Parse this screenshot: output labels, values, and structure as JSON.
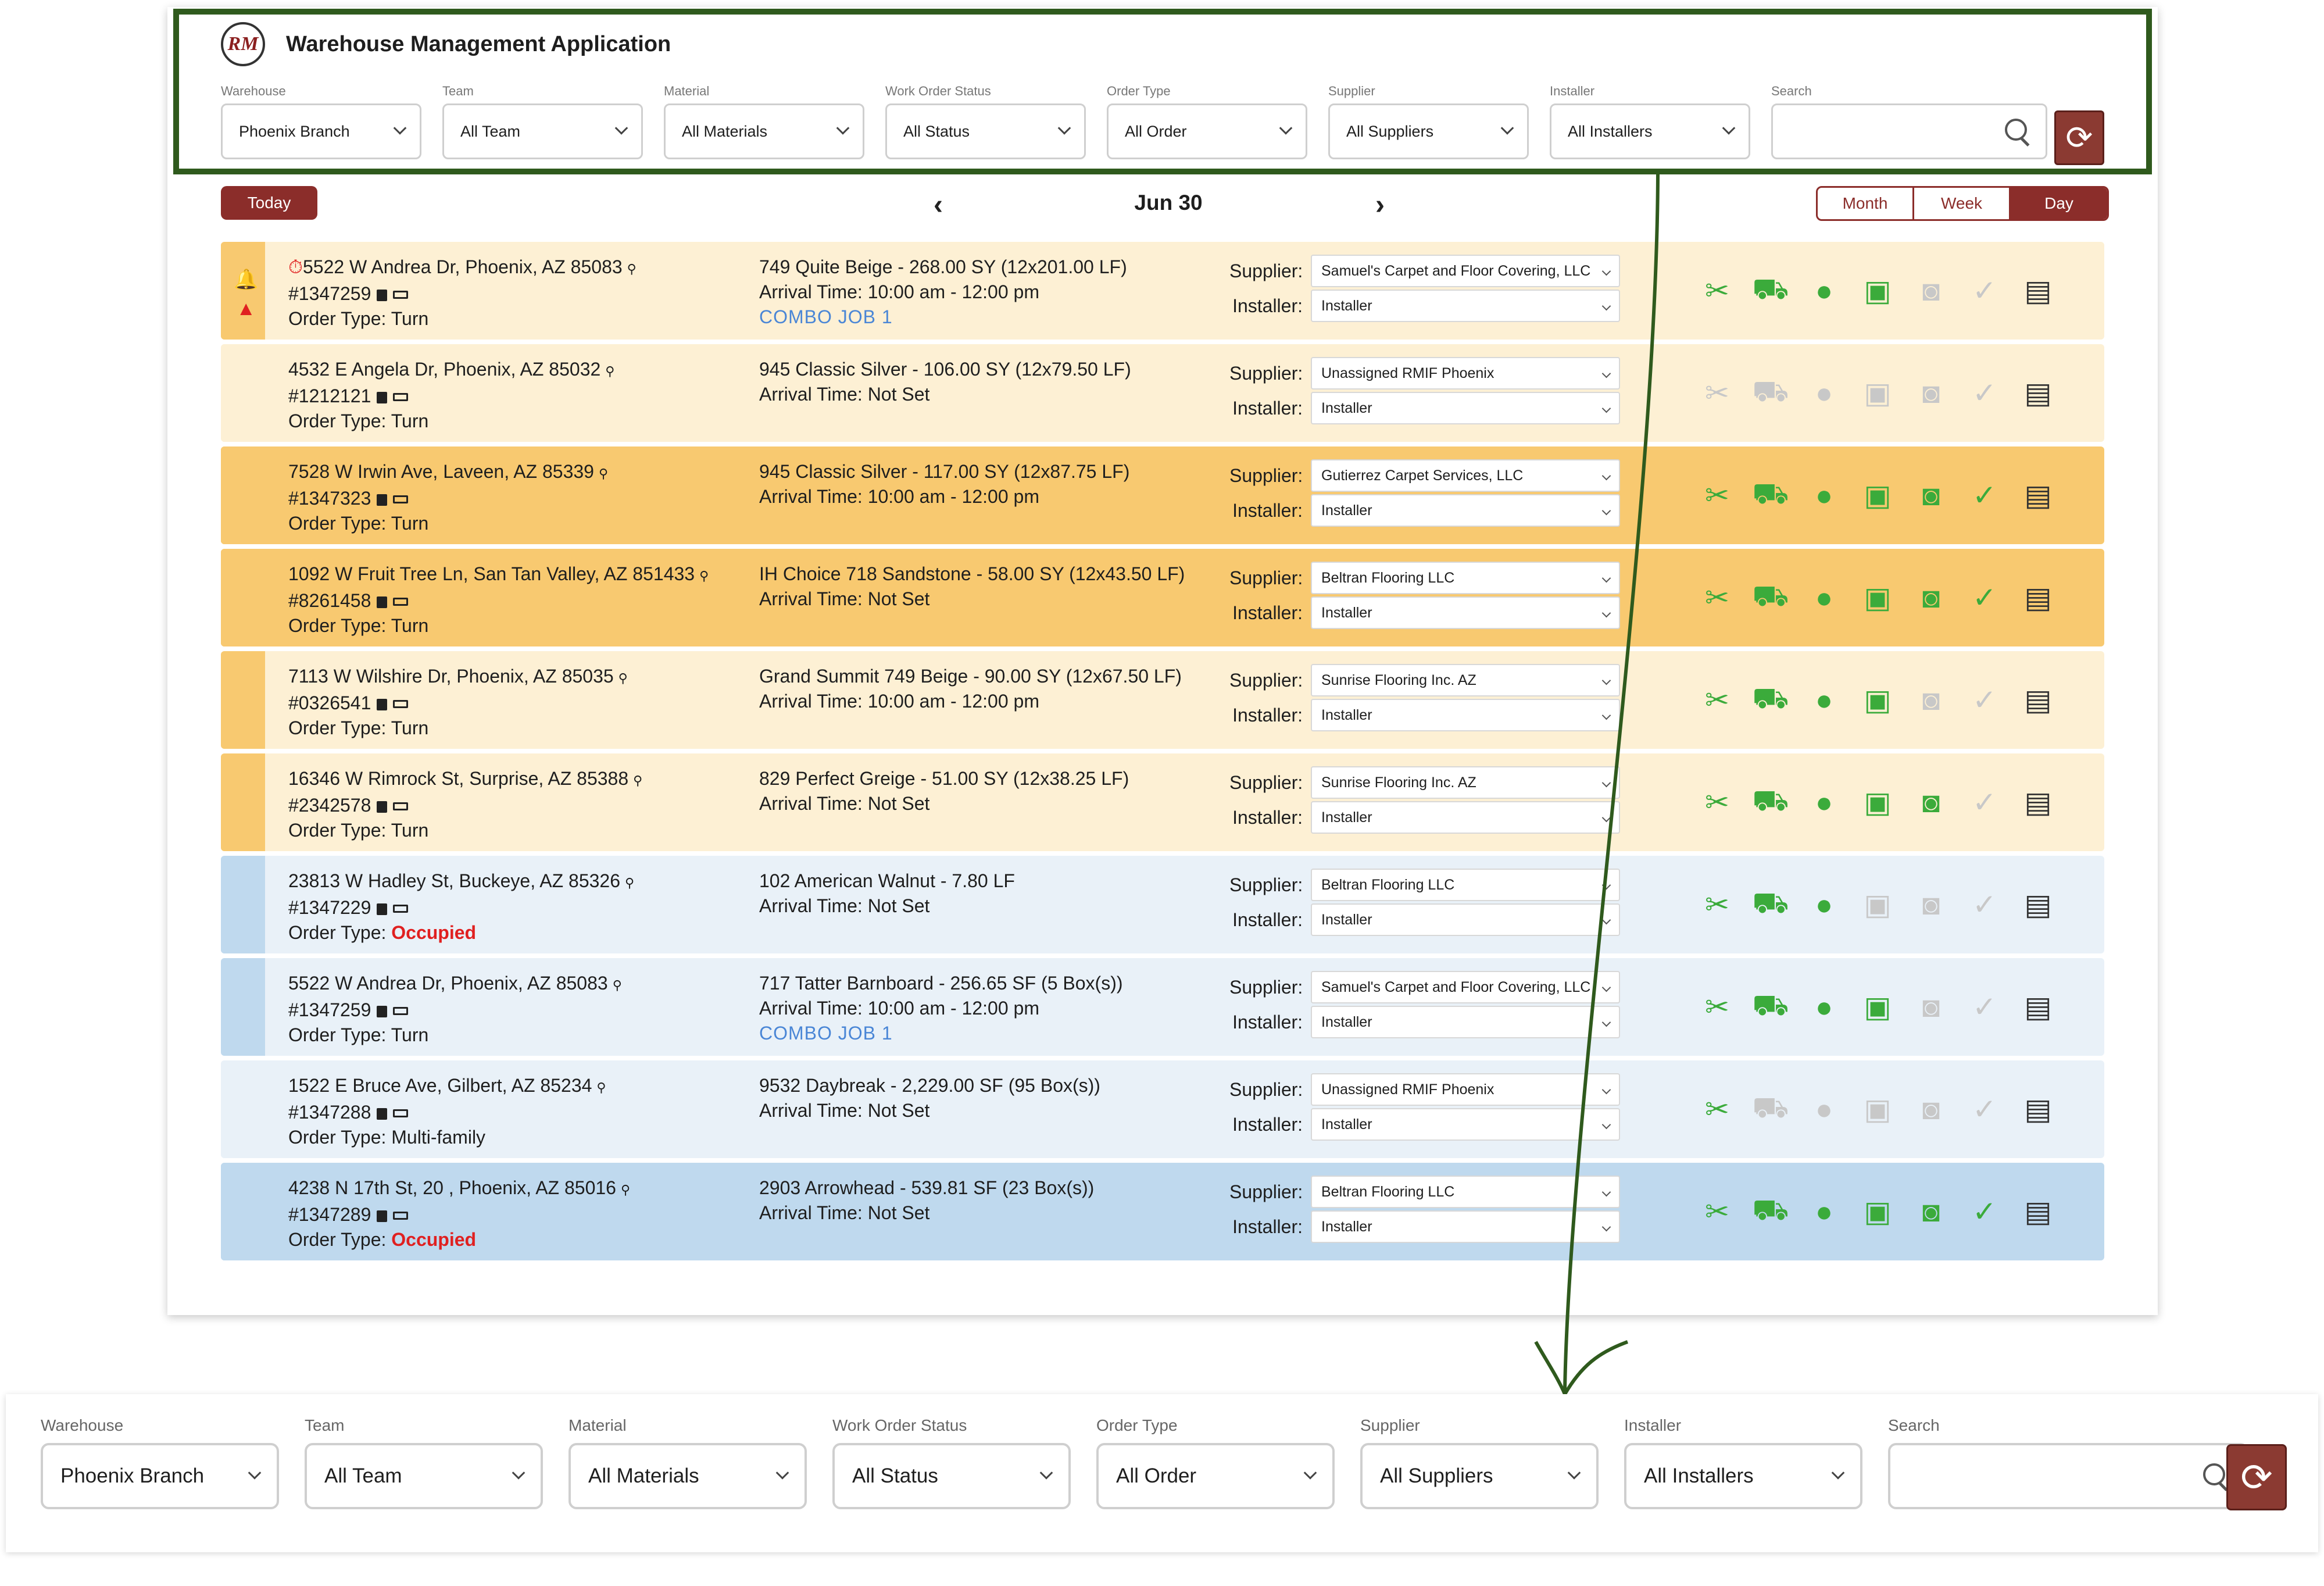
{
  "app": {
    "logo_text": "RM",
    "title": "Warehouse Management Application"
  },
  "filters": [
    {
      "label": "Warehouse",
      "value": "Phoenix Branch"
    },
    {
      "label": "Team",
      "value": "All Team"
    },
    {
      "label": "Material",
      "value": "All Materials"
    },
    {
      "label": "Work Order Status",
      "value": "All Status"
    },
    {
      "label": "Order Type",
      "value": "All Order"
    },
    {
      "label": "Supplier",
      "value": "All Suppliers"
    },
    {
      "label": "Installer",
      "value": "All Installers"
    }
  ],
  "search": {
    "label": "Search",
    "value": ""
  },
  "date_nav": {
    "today_label": "Today",
    "prev_glyph": "‹",
    "next_glyph": "›",
    "date": "Jun 30",
    "views": [
      "Month",
      "Week",
      "Day"
    ],
    "selected_view": "Day"
  },
  "colors": {
    "brand": "#8b2d2a",
    "row_cream": "#fdf0d4",
    "row_orange": "#f8c970",
    "row_lightblue": "#e9f1f8",
    "row_blue": "#bfd9ee",
    "icon_on": "#3bab3b",
    "icon_off": "#c8c8c8",
    "combo_blue": "#4a86d6",
    "alert_red": "#e02020"
  },
  "assign_labels": {
    "supplier": "Supplier:",
    "installer": "Installer:"
  },
  "rows": [
    {
      "address": "5522 W Andrea Dr, Phoenix, AZ 85083",
      "order": "#1347259",
      "type_label": "Order Type:",
      "type": "Turn",
      "type_alert": false,
      "material": "749 Quite Beige - 268.00 SY (12x201.00 LF)",
      "arrival": "Arrival Time: 10:00 am - 12:00 pm",
      "combo": "COMBO JOB 1",
      "supplier": "Samuel's Carpet and Floor Covering, LLC",
      "installer": "Installer",
      "bg": "#fdf0d4",
      "stripe": "#f8c970",
      "alerts": true,
      "icons": [
        "on",
        "on",
        "on",
        "on",
        "off",
        "off",
        "doc"
      ]
    },
    {
      "address": "4532 E Angela Dr, Phoenix, AZ 85032",
      "order": "#1212121",
      "type_label": "Order Type:",
      "type": "Turn",
      "type_alert": false,
      "material": "945 Classic Silver - 106.00 SY (12x79.50 LF)",
      "arrival": "Arrival Time: Not Set",
      "combo": "",
      "supplier": "Unassigned RMIF Phoenix",
      "installer": "Installer",
      "bg": "#fdf0d4",
      "stripe": "#fdf0d4",
      "alerts": false,
      "icons": [
        "off",
        "off",
        "off",
        "off",
        "off",
        "off",
        "doc"
      ]
    },
    {
      "address": "7528 W Irwin Ave, Laveen, AZ 85339",
      "order": "#1347323",
      "type_label": "Order Type:",
      "type": "Turn",
      "type_alert": false,
      "material": "945 Classic Silver - 117.00 SY (12x87.75 LF)",
      "arrival": "Arrival Time: 10:00 am - 12:00 pm",
      "combo": "",
      "supplier": "Gutierrez Carpet Services, LLC",
      "installer": "Installer",
      "bg": "#f8c970",
      "stripe": "#f8c970",
      "alerts": false,
      "icons": [
        "on",
        "on",
        "on",
        "on",
        "on",
        "on",
        "doc"
      ]
    },
    {
      "address": "1092 W Fruit Tree Ln, San Tan Valley, AZ 851433",
      "order": "#8261458",
      "type_label": "Order Type:",
      "type": "Turn",
      "type_alert": false,
      "material": "IH Choice 718 Sandstone - 58.00 SY (12x43.50 LF)",
      "arrival": "Arrival Time: Not Set",
      "combo": "",
      "supplier": "Beltran Flooring LLC",
      "installer": "Installer",
      "bg": "#f8c970",
      "stripe": "#f8c970",
      "alerts": false,
      "icons": [
        "on",
        "on",
        "on",
        "on",
        "on",
        "on",
        "doc"
      ]
    },
    {
      "address": "7113 W Wilshire Dr, Phoenix, AZ 85035",
      "order": "#0326541",
      "type_label": "Order Type:",
      "type": "Turn",
      "type_alert": false,
      "material": "Grand Summit 749 Beige - 90.00 SY (12x67.50 LF)",
      "arrival": "Arrival Time: 10:00 am - 12:00 pm",
      "combo": "",
      "supplier": "Sunrise Flooring Inc. AZ",
      "installer": "Installer",
      "bg": "#fdf0d4",
      "stripe": "#f8c970",
      "alerts": false,
      "icons": [
        "on",
        "on",
        "on",
        "on",
        "off",
        "off",
        "doc"
      ]
    },
    {
      "address": "16346 W Rimrock St, Surprise, AZ 85388",
      "order": "#2342578",
      "type_label": "Order Type:",
      "type": "Turn",
      "type_alert": false,
      "material": "829 Perfect Greige - 51.00 SY (12x38.25 LF)",
      "arrival": "Arrival Time: Not Set",
      "combo": "",
      "supplier": "Sunrise Flooring Inc. AZ",
      "installer": "Installer",
      "bg": "#fdf0d4",
      "stripe": "#f8c970",
      "alerts": false,
      "icons": [
        "on",
        "on",
        "on",
        "on",
        "on",
        "off",
        "doc"
      ]
    },
    {
      "address": "23813 W Hadley St, Buckeye, AZ 85326",
      "order": "#1347229",
      "type_label": "Order Type:",
      "type": "Occupied",
      "type_alert": true,
      "material": "102 American Walnut - 7.80 LF",
      "arrival": "Arrival Time: Not Set",
      "combo": "",
      "supplier": "Beltran Flooring LLC",
      "installer": "Installer",
      "bg": "#e9f1f8",
      "stripe": "#bfd9ee",
      "alerts": false,
      "icons": [
        "on",
        "on",
        "on",
        "off",
        "off",
        "off",
        "doc"
      ]
    },
    {
      "address": "5522 W Andrea Dr, Phoenix, AZ 85083",
      "order": "#1347259",
      "type_label": "Order Type:",
      "type": "Turn",
      "type_alert": false,
      "material": "717 Tatter Barnboard - 256.65 SF (5 Box(s))",
      "arrival": "Arrival Time: 10:00 am - 12:00 pm",
      "combo": "COMBO JOB 1",
      "supplier": "Samuel's Carpet and Floor Covering, LLC",
      "installer": "Installer",
      "bg": "#e9f1f8",
      "stripe": "#bfd9ee",
      "alerts": false,
      "icons": [
        "on",
        "on",
        "on",
        "on",
        "off",
        "off",
        "doc"
      ]
    },
    {
      "address": "1522 E Bruce Ave, Gilbert, AZ 85234",
      "order": "#1347288",
      "type_label": "Order Type:",
      "type": " Multi-family",
      "type_alert": false,
      "material": "9532 Daybreak - 2,229.00 SF (95 Box(s))",
      "arrival": "Arrival Time: Not Set",
      "combo": "",
      "supplier": "Unassigned RMIF Phoenix",
      "installer": "Installer",
      "bg": "#e9f1f8",
      "stripe": "#e9f1f8",
      "alerts": false,
      "icons": [
        "on",
        "off",
        "off",
        "off",
        "off",
        "off",
        "doc"
      ]
    },
    {
      "address": "4238 N 17th St, 20 , Phoenix, AZ 85016",
      "order": "#1347289",
      "type_label": "Order Type:",
      "type": "Occupied",
      "type_alert": true,
      "material": "2903 Arrowhead - 539.81 SF (23 Box(s))",
      "arrival": "Arrival Time: Not Set",
      "combo": "",
      "supplier": "Beltran Flooring LLC",
      "installer": "Installer",
      "bg": "#bfd9ee",
      "stripe": "#bfd9ee",
      "alerts": false,
      "icons": [
        "on",
        "on",
        "on",
        "on",
        "on",
        "on",
        "doc"
      ]
    }
  ],
  "action_icons": [
    "scissors-icon",
    "truck-icon",
    "user-icon",
    "photo-icon",
    "camera-icon",
    "check-icon",
    "add-document-icon"
  ],
  "action_glyphs": [
    "✂",
    "⛟",
    "●",
    "▣",
    "◙",
    "✓",
    "▤"
  ]
}
